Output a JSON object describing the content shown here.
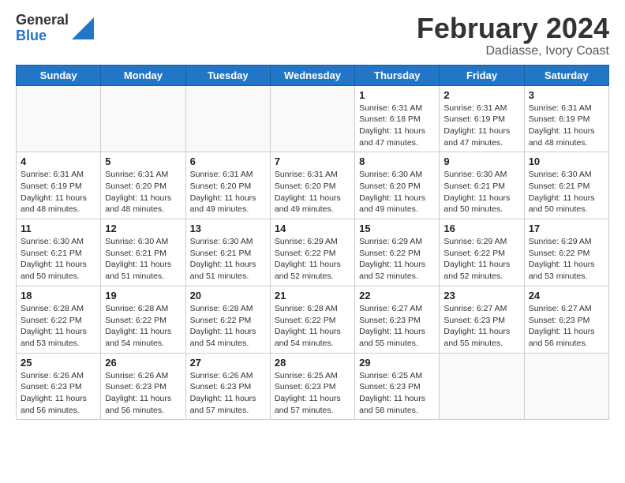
{
  "logo": {
    "general": "General",
    "blue": "Blue"
  },
  "title": "February 2024",
  "subtitle": "Dadiasse, Ivory Coast",
  "days_of_week": [
    "Sunday",
    "Monday",
    "Tuesday",
    "Wednesday",
    "Thursday",
    "Friday",
    "Saturday"
  ],
  "weeks": [
    [
      {
        "num": "",
        "info": ""
      },
      {
        "num": "",
        "info": ""
      },
      {
        "num": "",
        "info": ""
      },
      {
        "num": "",
        "info": ""
      },
      {
        "num": "1",
        "info": "Sunrise: 6:31 AM\nSunset: 6:18 PM\nDaylight: 11 hours and 47 minutes."
      },
      {
        "num": "2",
        "info": "Sunrise: 6:31 AM\nSunset: 6:19 PM\nDaylight: 11 hours and 47 minutes."
      },
      {
        "num": "3",
        "info": "Sunrise: 6:31 AM\nSunset: 6:19 PM\nDaylight: 11 hours and 48 minutes."
      }
    ],
    [
      {
        "num": "4",
        "info": "Sunrise: 6:31 AM\nSunset: 6:19 PM\nDaylight: 11 hours and 48 minutes."
      },
      {
        "num": "5",
        "info": "Sunrise: 6:31 AM\nSunset: 6:20 PM\nDaylight: 11 hours and 48 minutes."
      },
      {
        "num": "6",
        "info": "Sunrise: 6:31 AM\nSunset: 6:20 PM\nDaylight: 11 hours and 49 minutes."
      },
      {
        "num": "7",
        "info": "Sunrise: 6:31 AM\nSunset: 6:20 PM\nDaylight: 11 hours and 49 minutes."
      },
      {
        "num": "8",
        "info": "Sunrise: 6:30 AM\nSunset: 6:20 PM\nDaylight: 11 hours and 49 minutes."
      },
      {
        "num": "9",
        "info": "Sunrise: 6:30 AM\nSunset: 6:21 PM\nDaylight: 11 hours and 50 minutes."
      },
      {
        "num": "10",
        "info": "Sunrise: 6:30 AM\nSunset: 6:21 PM\nDaylight: 11 hours and 50 minutes."
      }
    ],
    [
      {
        "num": "11",
        "info": "Sunrise: 6:30 AM\nSunset: 6:21 PM\nDaylight: 11 hours and 50 minutes."
      },
      {
        "num": "12",
        "info": "Sunrise: 6:30 AM\nSunset: 6:21 PM\nDaylight: 11 hours and 51 minutes."
      },
      {
        "num": "13",
        "info": "Sunrise: 6:30 AM\nSunset: 6:21 PM\nDaylight: 11 hours and 51 minutes."
      },
      {
        "num": "14",
        "info": "Sunrise: 6:29 AM\nSunset: 6:22 PM\nDaylight: 11 hours and 52 minutes."
      },
      {
        "num": "15",
        "info": "Sunrise: 6:29 AM\nSunset: 6:22 PM\nDaylight: 11 hours and 52 minutes."
      },
      {
        "num": "16",
        "info": "Sunrise: 6:29 AM\nSunset: 6:22 PM\nDaylight: 11 hours and 52 minutes."
      },
      {
        "num": "17",
        "info": "Sunrise: 6:29 AM\nSunset: 6:22 PM\nDaylight: 11 hours and 53 minutes."
      }
    ],
    [
      {
        "num": "18",
        "info": "Sunrise: 6:28 AM\nSunset: 6:22 PM\nDaylight: 11 hours and 53 minutes."
      },
      {
        "num": "19",
        "info": "Sunrise: 6:28 AM\nSunset: 6:22 PM\nDaylight: 11 hours and 54 minutes."
      },
      {
        "num": "20",
        "info": "Sunrise: 6:28 AM\nSunset: 6:22 PM\nDaylight: 11 hours and 54 minutes."
      },
      {
        "num": "21",
        "info": "Sunrise: 6:28 AM\nSunset: 6:22 PM\nDaylight: 11 hours and 54 minutes."
      },
      {
        "num": "22",
        "info": "Sunrise: 6:27 AM\nSunset: 6:23 PM\nDaylight: 11 hours and 55 minutes."
      },
      {
        "num": "23",
        "info": "Sunrise: 6:27 AM\nSunset: 6:23 PM\nDaylight: 11 hours and 55 minutes."
      },
      {
        "num": "24",
        "info": "Sunrise: 6:27 AM\nSunset: 6:23 PM\nDaylight: 11 hours and 56 minutes."
      }
    ],
    [
      {
        "num": "25",
        "info": "Sunrise: 6:26 AM\nSunset: 6:23 PM\nDaylight: 11 hours and 56 minutes."
      },
      {
        "num": "26",
        "info": "Sunrise: 6:26 AM\nSunset: 6:23 PM\nDaylight: 11 hours and 56 minutes."
      },
      {
        "num": "27",
        "info": "Sunrise: 6:26 AM\nSunset: 6:23 PM\nDaylight: 11 hours and 57 minutes."
      },
      {
        "num": "28",
        "info": "Sunrise: 6:25 AM\nSunset: 6:23 PM\nDaylight: 11 hours and 57 minutes."
      },
      {
        "num": "29",
        "info": "Sunrise: 6:25 AM\nSunset: 6:23 PM\nDaylight: 11 hours and 58 minutes."
      },
      {
        "num": "",
        "info": ""
      },
      {
        "num": "",
        "info": ""
      }
    ]
  ]
}
